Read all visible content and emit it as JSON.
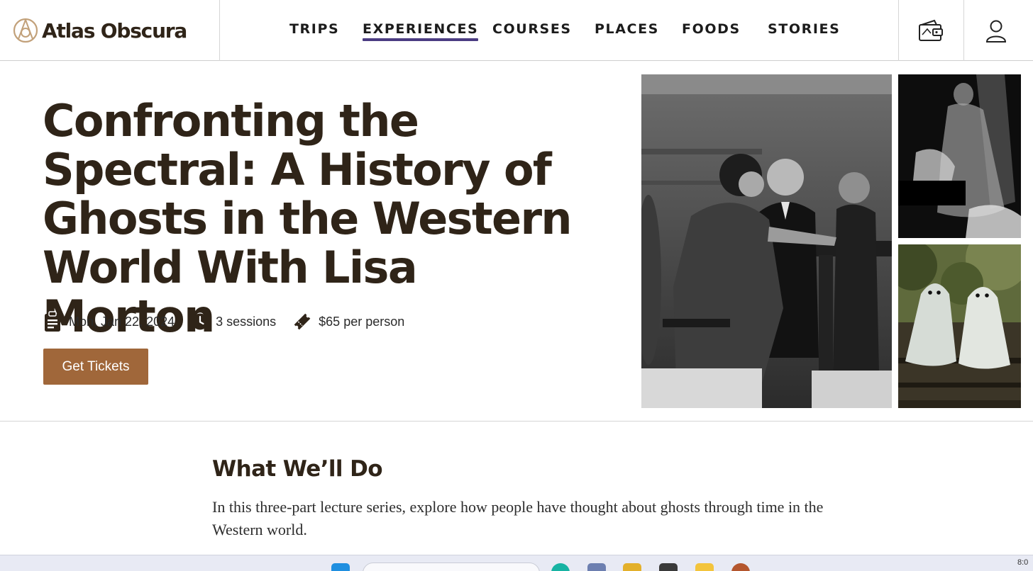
{
  "brand": {
    "name": "Atlas Obscura"
  },
  "nav": {
    "items": [
      {
        "label": "TRIPS",
        "active": false
      },
      {
        "label": "EXPERIENCES",
        "active": true
      },
      {
        "label": "COURSES",
        "active": false
      },
      {
        "label": "PLACES",
        "active": false
      },
      {
        "label": "FOODS",
        "active": false
      },
      {
        "label": "STORIES",
        "active": false
      }
    ],
    "icons": [
      "wallet-icon",
      "user-icon"
    ]
  },
  "hero": {
    "title": "Confronting the Spectral: A History of Ghosts in the Western World With Lisa Morton",
    "meta": {
      "date": "Mon, Jan 22, 2024",
      "sessions": "3 sessions",
      "price": "$65 per person"
    },
    "cta_label": "Get Tickets"
  },
  "section": {
    "title": "What We’ll Do",
    "body": "In this three-part lecture series, explore how people have thought about ghosts through time in the Western world."
  },
  "taskbar": {
    "time": "8:0"
  },
  "colors": {
    "brand_text": "#2f2418",
    "logo_ring": "#c2a17a",
    "nav_active_underline": "#4b3c82",
    "cta": "#a0673a",
    "divider": "#d6d6d6"
  }
}
